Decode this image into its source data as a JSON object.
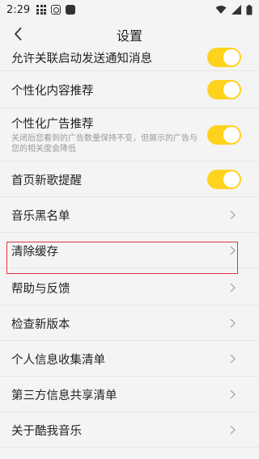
{
  "status": {
    "time": "2:29"
  },
  "header": {
    "title": "设置"
  },
  "settings": [
    {
      "label": "允许关联启动发送通知消息",
      "type": "toggle",
      "on": true
    },
    {
      "label": "个性化内容推荐",
      "type": "toggle",
      "on": true
    },
    {
      "label": "个性化广告推荐",
      "sublabel": "关闭后您看到的广告数量保持不变，但展示的广告与您的相关度会降低",
      "type": "toggle",
      "on": true
    },
    {
      "label": "首页新歌提醒",
      "type": "toggle",
      "on": true
    },
    {
      "label": "音乐黑名单",
      "type": "link"
    },
    {
      "label": "清除缓存",
      "type": "link",
      "highlighted": true
    },
    {
      "label": "帮助与反馈",
      "type": "link"
    },
    {
      "label": "检查新版本",
      "type": "link"
    },
    {
      "label": "个人信息收集清单",
      "type": "link"
    },
    {
      "label": "第三方信息共享清单",
      "type": "link"
    },
    {
      "label": "关于酷我音乐",
      "type": "link"
    }
  ],
  "colors": {
    "toggle_on": "#ffd21e",
    "highlight_border": "#e0353b",
    "background": "#f4f4f4"
  }
}
